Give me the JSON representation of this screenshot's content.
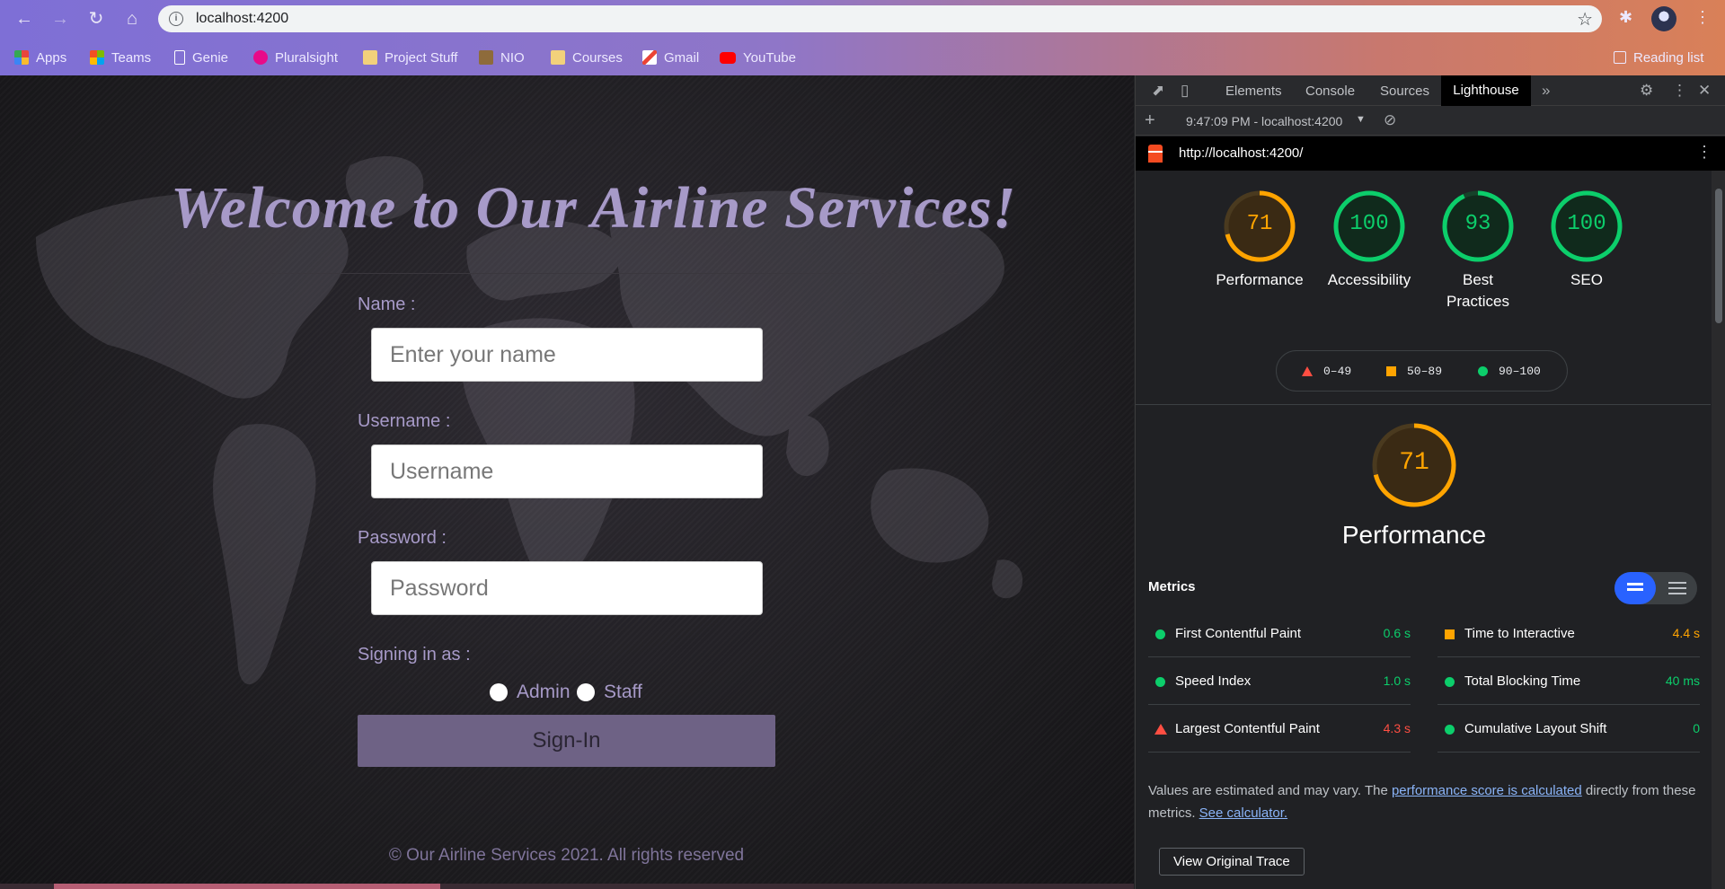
{
  "browser": {
    "url": "localhost:4200",
    "bookmarks": [
      {
        "label": "Apps",
        "color": "#e8453c"
      },
      {
        "label": "Teams",
        "color": "#f25022"
      },
      {
        "label": "Genie",
        "color": "#ffffff"
      },
      {
        "label": "Pluralsight",
        "color": "#e80a89"
      },
      {
        "label": "Project Stuff",
        "color": "#f2d17b"
      },
      {
        "label": "NIO",
        "color": "#8e6b3b"
      },
      {
        "label": "Courses",
        "color": "#f2d17b"
      },
      {
        "label": "Gmail",
        "color": "#ffffff"
      },
      {
        "label": "YouTube",
        "color": "#ff0000"
      }
    ],
    "reading_list": "Reading list"
  },
  "page": {
    "title": "Welcome to Our Airline Services!",
    "name_label": "Name :",
    "name_placeholder": "Enter your name",
    "username_label": "Username :",
    "username_placeholder": "Username",
    "password_label": "Password :",
    "password_placeholder": "Password",
    "role_label": "Signing in as :",
    "role_admin": "Admin",
    "role_staff": "Staff",
    "signin_label": "Sign-In",
    "footer": "© Our Airline Services 2021. All rights reserved"
  },
  "devtools": {
    "tabs": [
      "Elements",
      "Console",
      "Sources",
      "Lighthouse"
    ],
    "active_tab": "Lighthouse",
    "report_selector": "9:47:09 PM - localhost:4200",
    "report_url": "http://localhost:4200/",
    "scores": [
      {
        "label": "Performance",
        "value": 71,
        "color": "#ffa400"
      },
      {
        "label": "Accessibility",
        "value": 100,
        "color": "#0cce6b"
      },
      {
        "label": "Best Practices",
        "value": 93,
        "color": "#0cce6b"
      },
      {
        "label": "SEO",
        "value": 100,
        "color": "#0cce6b"
      }
    ],
    "legend": [
      "0–49",
      "50–89",
      "90–100"
    ],
    "performance_score": "71",
    "performance_title": "Performance",
    "metrics_title": "Metrics",
    "metrics": [
      {
        "name": "First Contentful Paint",
        "value": "0.6 s",
        "status": "pass"
      },
      {
        "name": "Time to Interactive",
        "value": "4.4 s",
        "status": "average"
      },
      {
        "name": "Speed Index",
        "value": "1.0 s",
        "status": "pass"
      },
      {
        "name": "Total Blocking Time",
        "value": "40 ms",
        "status": "pass"
      },
      {
        "name": "Largest Contentful Paint",
        "value": "4.3 s",
        "status": "fail"
      },
      {
        "name": "Cumulative Layout Shift",
        "value": "0",
        "status": "pass"
      }
    ],
    "note_prefix": "Values are estimated and may vary. The ",
    "note_link1": "performance score is calculated",
    "note_middle": " directly from these metrics. ",
    "note_link2": "See calculator.",
    "view_trace": "View Original Trace"
  },
  "colors": {
    "pass": "#0cce6b",
    "average": "#ffa400",
    "fail": "#ff4e42"
  }
}
